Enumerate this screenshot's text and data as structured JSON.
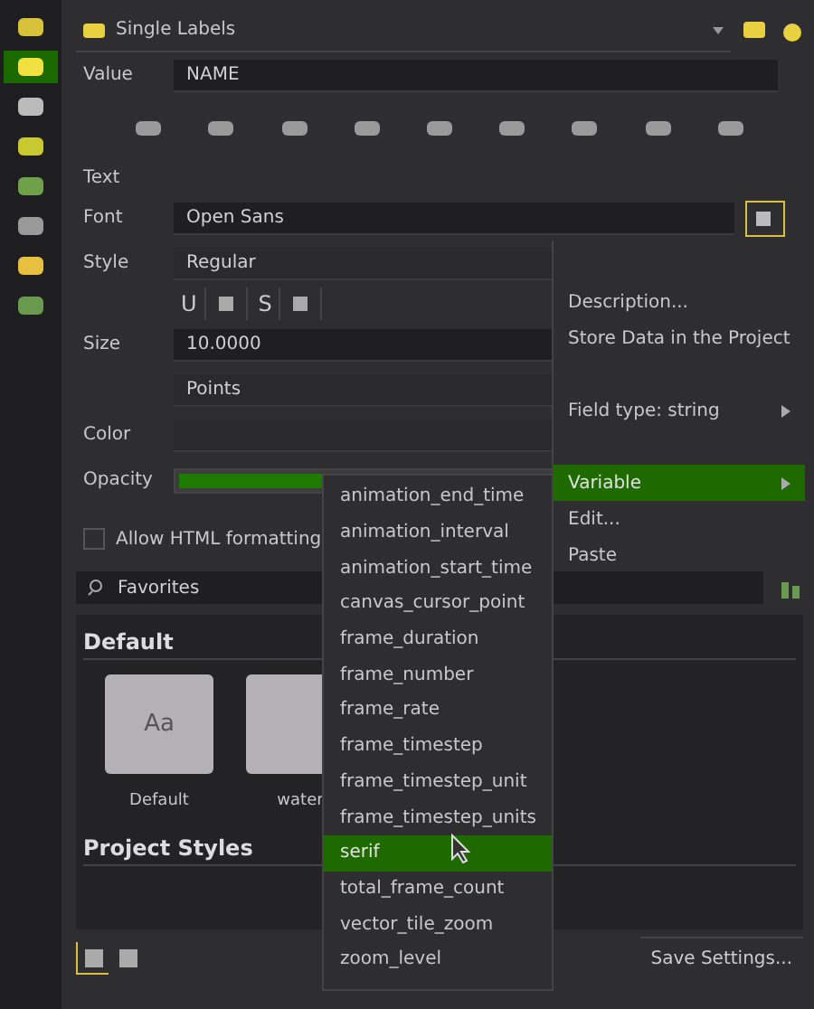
{
  "renderer": {
    "label": "Single Labels"
  },
  "sidebar": [
    {
      "selected": false
    },
    {
      "selected": true
    },
    {
      "selected": false
    },
    {
      "selected": false
    },
    {
      "selected": false
    },
    {
      "selected": false
    },
    {
      "selected": false
    },
    {
      "selected": false
    }
  ],
  "value_field": {
    "label": "Value",
    "value": "NAME"
  },
  "section_title": "Text",
  "font": {
    "label": "Font",
    "value": "Open Sans"
  },
  "style": {
    "label": "Style",
    "value": "Regular"
  },
  "format_buttons": [
    {
      "kind": "text",
      "text": "U"
    },
    {
      "kind": "icon"
    },
    {
      "kind": "text",
      "text": "S"
    },
    {
      "kind": "icon"
    }
  ],
  "size": {
    "label": "Size",
    "value": "10.0000",
    "unit": "Points"
  },
  "color": {
    "label": "Color"
  },
  "opacity": {
    "label": "Opacity",
    "level": 1
  },
  "allow_html": {
    "label": "Allow HTML formatting",
    "checked": false
  },
  "search": {
    "value": "Favorites"
  },
  "style_groups": [
    {
      "title": "Default",
      "items": [
        {
          "label": "Default",
          "preview": "Aa"
        },
        {
          "label": "water"
        }
      ]
    },
    {
      "title": "Project Styles"
    }
  ],
  "view_modes": [
    {
      "selected": true
    },
    {
      "selected": false
    }
  ],
  "save_button": "Save Settings...",
  "context_menu": [
    {
      "kind": "item",
      "label": "Description...",
      "selected": false
    },
    {
      "kind": "item",
      "label": "Store Data in the Project",
      "selected": false
    },
    {
      "kind": "spacer"
    },
    {
      "kind": "submenu",
      "label": "Field type: string",
      "selected": false
    },
    {
      "kind": "spacer"
    },
    {
      "kind": "submenu",
      "label": "Variable",
      "selected": true
    },
    {
      "kind": "item",
      "label": "Edit...",
      "selected": false
    },
    {
      "kind": "item",
      "label": "Paste",
      "selected": false
    }
  ],
  "variables_menu": [
    {
      "label": "animation_end_time",
      "selected": false
    },
    {
      "label": "animation_interval",
      "selected": false
    },
    {
      "label": "animation_start_time",
      "selected": false
    },
    {
      "label": "canvas_cursor_point",
      "selected": false
    },
    {
      "label": "frame_duration",
      "selected": false
    },
    {
      "label": "frame_number",
      "selected": false
    },
    {
      "label": "frame_rate",
      "selected": false
    },
    {
      "label": "frame_timestep",
      "selected": false
    },
    {
      "label": "frame_timestep_unit",
      "selected": false
    },
    {
      "label": "frame_timestep_units",
      "selected": false
    },
    {
      "label": "serif",
      "selected": true
    },
    {
      "label": "total_frame_count",
      "selected": false
    },
    {
      "label": "vector_tile_zoom",
      "selected": false
    },
    {
      "label": "zoom_level",
      "selected": false
    }
  ]
}
